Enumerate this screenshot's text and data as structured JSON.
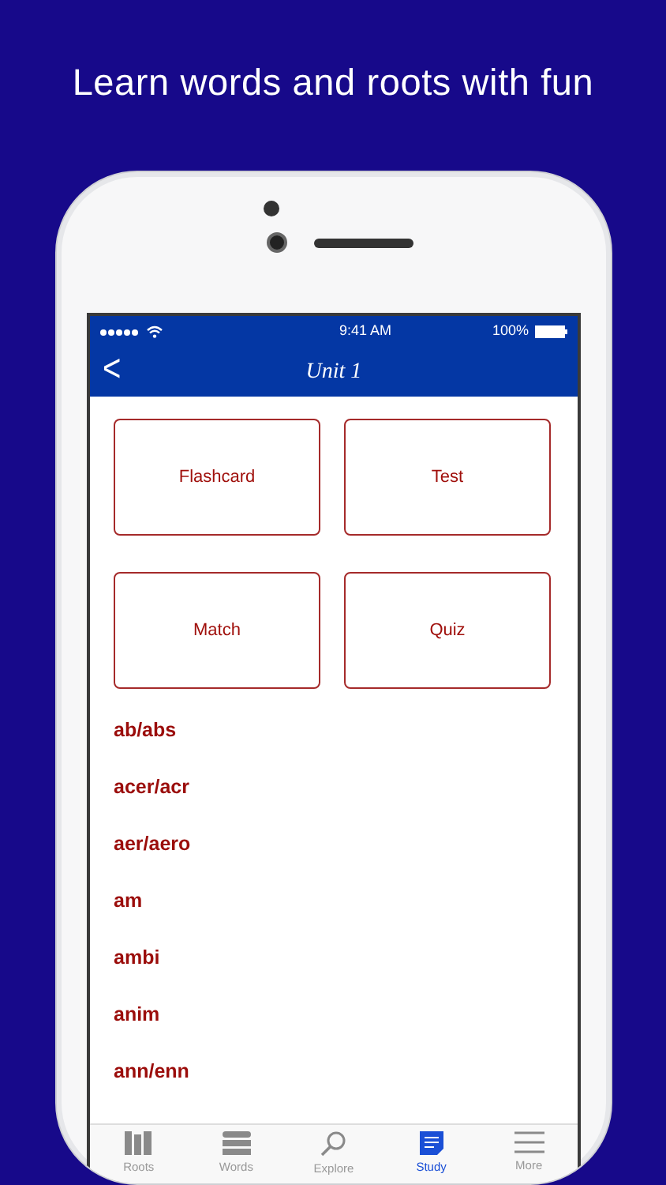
{
  "headline": "Learn words and roots with fun",
  "status_bar": {
    "time": "9:41 AM",
    "battery": "100%"
  },
  "nav": {
    "back": "<",
    "title": "Unit 1"
  },
  "modes": [
    {
      "label": "Flashcard"
    },
    {
      "label": "Test"
    },
    {
      "label": "Match"
    },
    {
      "label": "Quiz"
    }
  ],
  "roots": [
    "ab/abs",
    "acer/acr",
    "aer/aero",
    "am",
    "ambi",
    "anim",
    "ann/enn"
  ],
  "tabs": [
    {
      "label": "Roots",
      "kind": "books",
      "selected": false
    },
    {
      "label": "Words",
      "kind": "stack",
      "selected": false
    },
    {
      "label": "Explore",
      "kind": "search",
      "selected": false
    },
    {
      "label": "Study",
      "kind": "note",
      "selected": true
    },
    {
      "label": "More",
      "kind": "menu",
      "selected": false
    }
  ]
}
